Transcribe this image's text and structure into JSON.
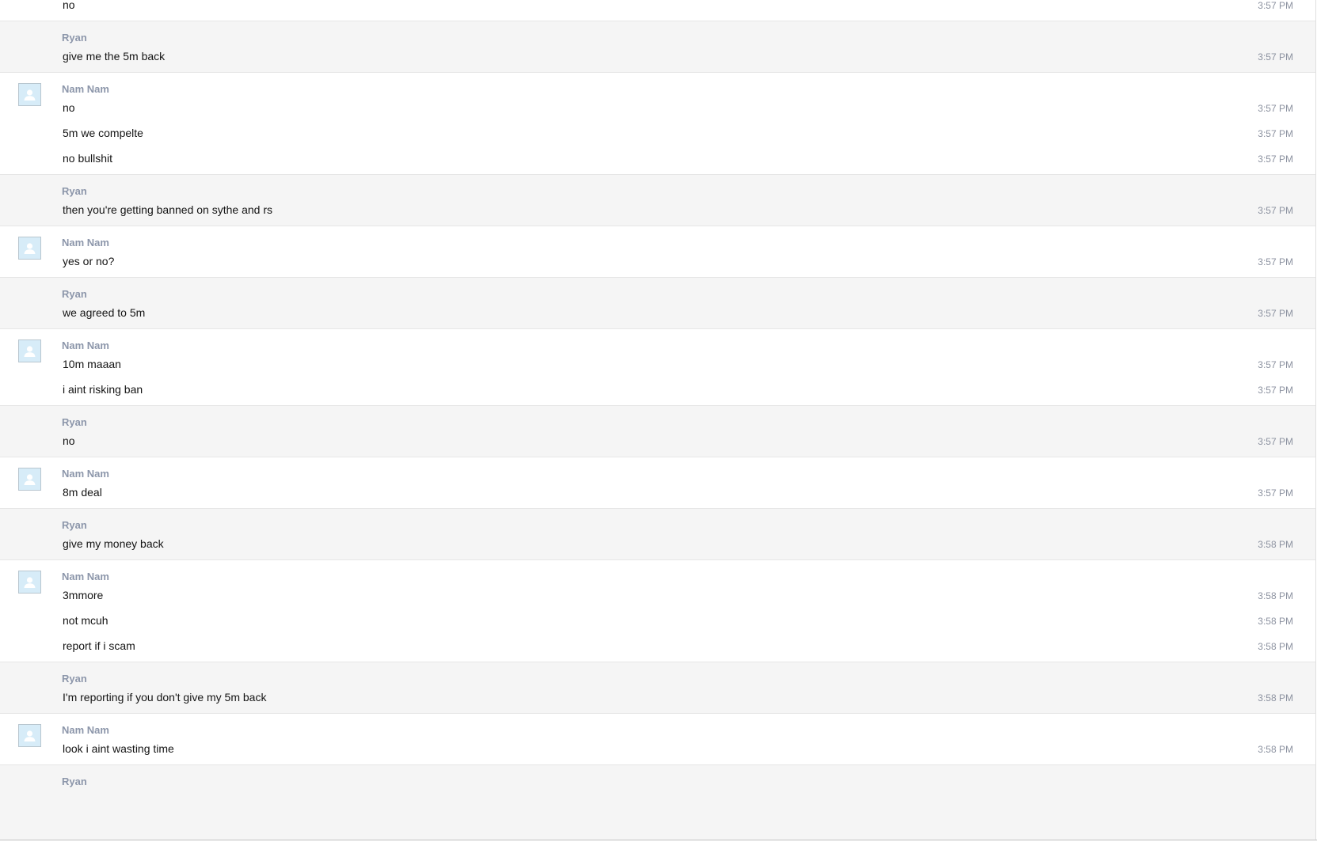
{
  "conversation": {
    "groups": [
      {
        "sender": "",
        "avatar": "user-avatar-icon",
        "messages": [
          {
            "text": "no",
            "time": "3:57 PM"
          }
        ]
      },
      {
        "sender": "Ryan",
        "messages": [
          {
            "text": "give me the 5m back",
            "time": "3:57 PM"
          }
        ]
      },
      {
        "sender": "Nam Nam",
        "avatar": "user-avatar-icon",
        "messages": [
          {
            "text": "no",
            "time": "3:57 PM"
          },
          {
            "text": "5m we compelte",
            "time": "3:57 PM"
          },
          {
            "text": "no bullshit",
            "time": "3:57 PM"
          }
        ]
      },
      {
        "sender": "Ryan",
        "messages": [
          {
            "text": "then you're getting banned on sythe and rs",
            "time": "3:57 PM"
          }
        ]
      },
      {
        "sender": "Nam Nam",
        "avatar": "user-avatar-icon",
        "messages": [
          {
            "text": "yes or no?",
            "time": "3:57 PM"
          }
        ]
      },
      {
        "sender": "Ryan",
        "messages": [
          {
            "text": "we agreed to 5m",
            "time": "3:57 PM"
          }
        ]
      },
      {
        "sender": "Nam Nam",
        "avatar": "user-avatar-icon",
        "messages": [
          {
            "text": "10m maaan",
            "time": "3:57 PM"
          },
          {
            "text": "i aint risking ban",
            "time": "3:57 PM"
          }
        ]
      },
      {
        "sender": "Ryan",
        "messages": [
          {
            "text": "no",
            "time": "3:57 PM"
          }
        ]
      },
      {
        "sender": "Nam Nam",
        "avatar": "user-avatar-icon",
        "messages": [
          {
            "text": "8m deal",
            "time": "3:57 PM"
          }
        ]
      },
      {
        "sender": "Ryan",
        "messages": [
          {
            "text": "give my money back",
            "time": "3:58 PM"
          }
        ]
      },
      {
        "sender": "Nam Nam",
        "avatar": "user-avatar-icon",
        "messages": [
          {
            "text": "3mmore",
            "time": "3:58 PM"
          },
          {
            "text": "not mcuh",
            "time": "3:58 PM"
          },
          {
            "text": "report if i scam",
            "time": "3:58 PM"
          }
        ]
      },
      {
        "sender": "Ryan",
        "messages": [
          {
            "text": "I'm reporting if you don't give my 5m back",
            "time": "3:58 PM"
          }
        ]
      },
      {
        "sender": "Nam Nam",
        "avatar": "user-avatar-icon",
        "messages": [
          {
            "text": "look i aint wasting time",
            "time": "3:58 PM"
          }
        ]
      },
      {
        "sender": "Ryan",
        "messages": []
      }
    ]
  }
}
